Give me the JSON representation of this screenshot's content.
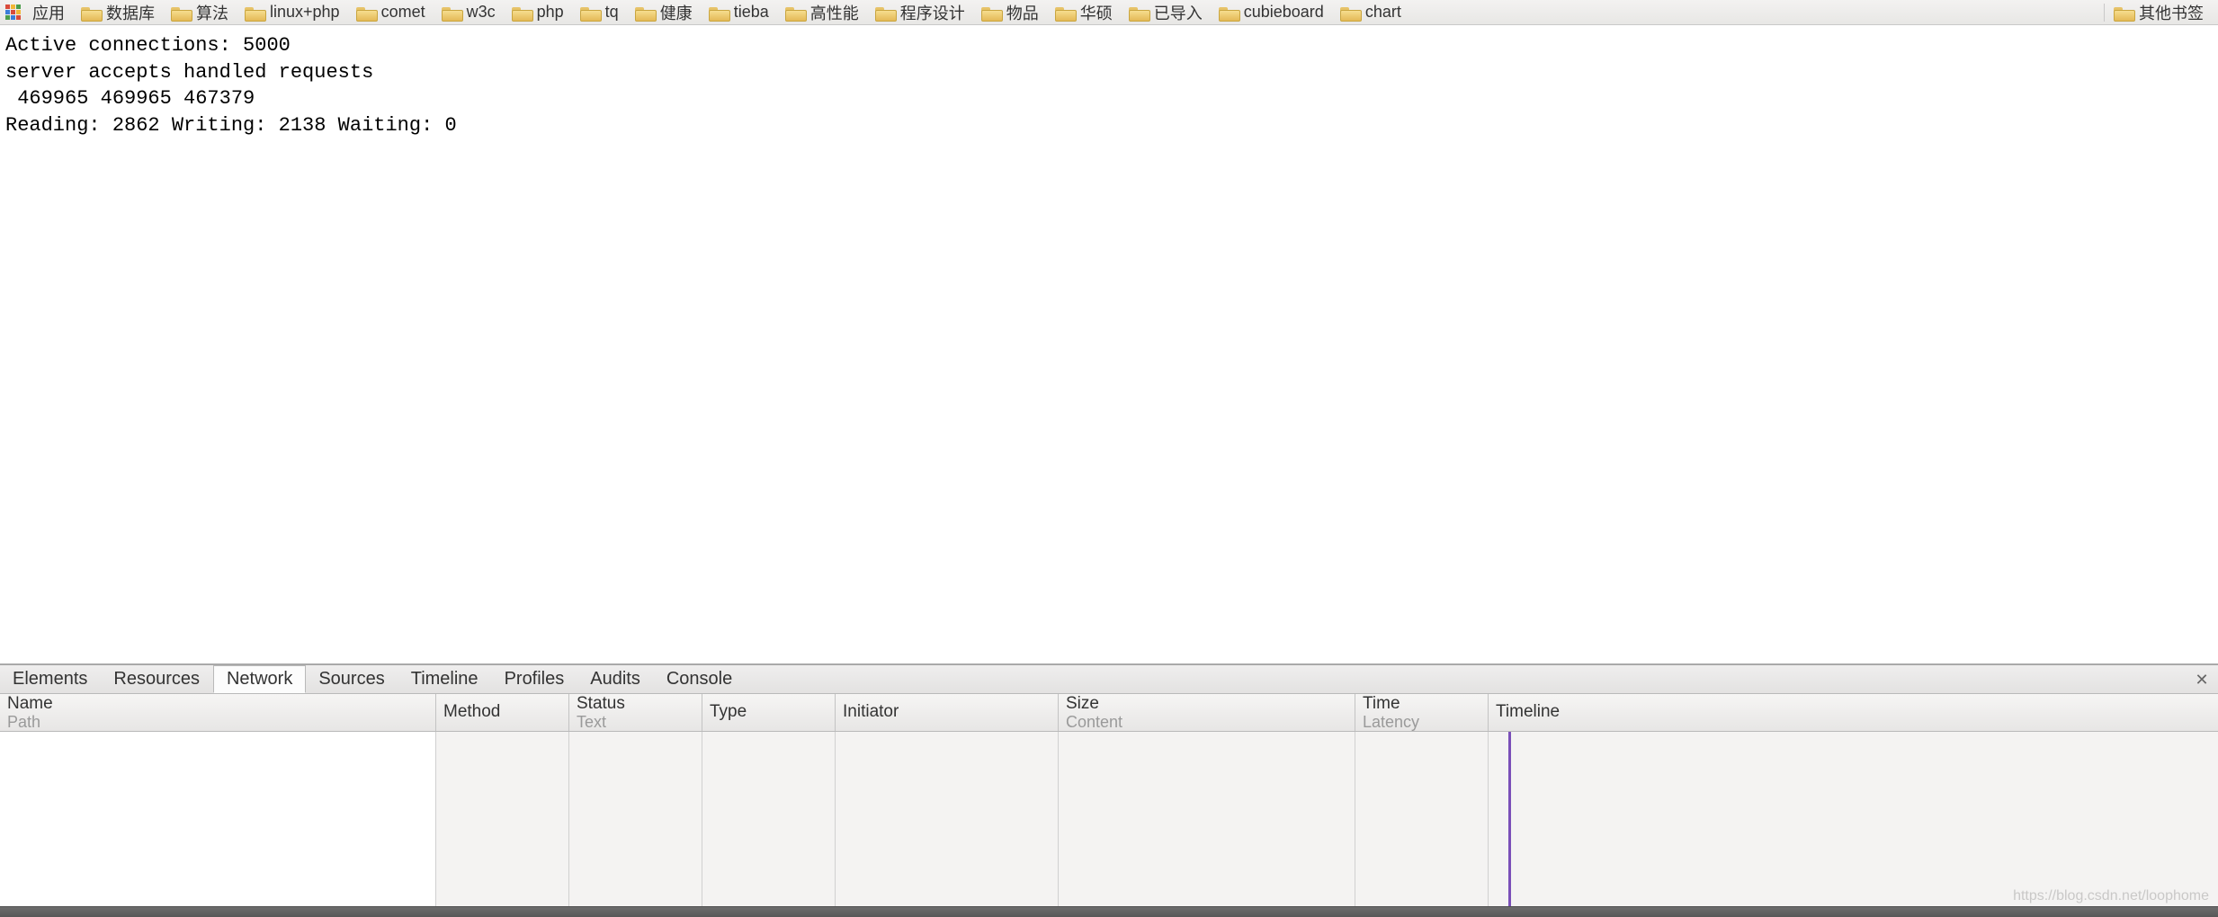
{
  "bookmarks": {
    "apps_label": "应用",
    "items": [
      "数据库",
      "算法",
      "linux+php",
      "comet",
      "w3c",
      "php",
      "tq",
      "健康",
      "tieba",
      "高性能",
      "程序设计",
      "物品",
      "华硕",
      "已导入",
      "cubieboard",
      "chart"
    ],
    "other_label": "其他书签"
  },
  "page": {
    "line1": "Active connections: 5000",
    "line2": "server accepts handled requests",
    "line3": " 469965 469965 467379",
    "line4": "Reading: 2862 Writing: 2138 Waiting: 0"
  },
  "devtools": {
    "tabs": [
      "Elements",
      "Resources",
      "Network",
      "Sources",
      "Timeline",
      "Profiles",
      "Audits",
      "Console"
    ],
    "active_tab_index": 2,
    "close_glyph": "✕",
    "columns": {
      "name": "Name",
      "name_sub": "Path",
      "method": "Method",
      "status": "Status",
      "status_sub": "Text",
      "type": "Type",
      "initiator": "Initiator",
      "size": "Size",
      "size_sub": "Content",
      "time": "Time",
      "time_sub": "Latency",
      "timeline": "Timeline"
    }
  },
  "watermark": "https://blog.csdn.net/loophome"
}
